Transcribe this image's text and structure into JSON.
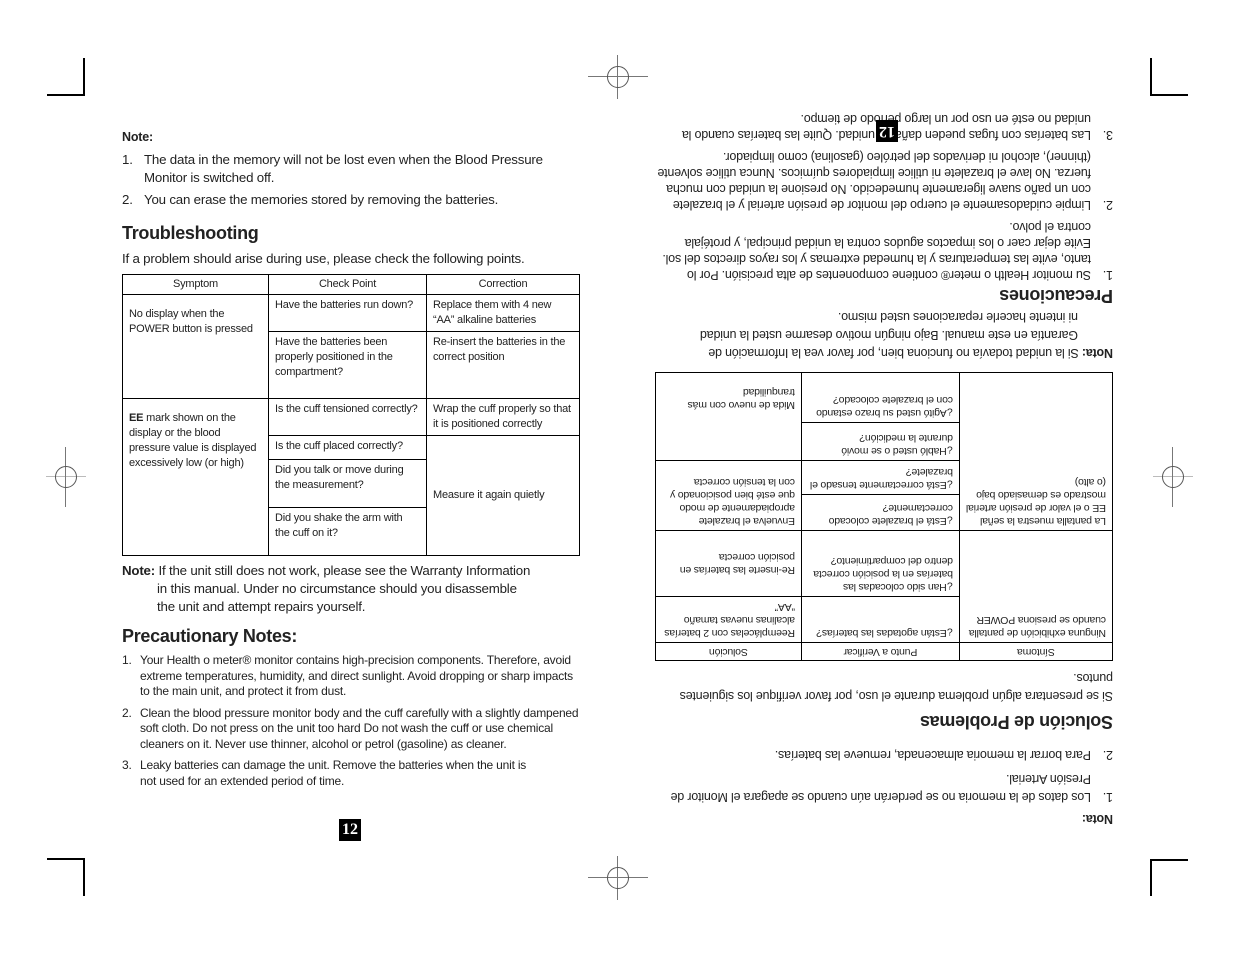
{
  "english": {
    "note_label": "Note:",
    "notes": [
      {
        "num": "1.",
        "text": "The data in the memory will not be lost even when the Blood Pressure Monitor is switched off."
      },
      {
        "num": "2.",
        "text": "You can erase the memories stored by removing the batteries."
      }
    ],
    "troubleshooting_title": "Troubleshooting",
    "troubleshooting_intro": "If a problem should arise during use, please check the following points.",
    "table": {
      "headers": [
        "Symptom",
        "Check Point",
        "Correction"
      ],
      "symptom1": "No display when the POWER button is pressed",
      "check1a": "Have the batteries run down?",
      "corr1a": "Replace them with 4 new “AA” alkaline batteries",
      "check1b": "Have the batteries been properly positioned in the compartment?",
      "corr1b": "Re-insert the batteries in the correct position",
      "symptom2_bold": "EE",
      "symptom2": " mark shown on the display or the blood pressure value is displayed excessively low (or high)",
      "check2a": "Is the cuff tensioned correctly?",
      "corr2a": "Wrap the cuff properly so that it is positioned correctly",
      "check2b": "Is the cuff placed correctly?",
      "check2c": "Did you talk or move during the measurement?",
      "check2d": "Did you shake the arm with the cuff on it?",
      "corr2bcd": "Measure it again quietly"
    },
    "warranty_label": "Note:",
    "warranty_text1": " If the unit still does not work, please see the Warranty Information",
    "warranty_text2": "in this manual. Under no circumstance should you disassemble",
    "warranty_text3": "the unit and attempt repairs yourself.",
    "precaution_title": "Precautionary Notes:",
    "precautions": [
      {
        "num": "1.",
        "text": "Your Health o meter® monitor contains high-precision components. Therefore, avoid extreme temperatures, humidity, and direct sunlight. Avoid dropping or sharp impacts to the main unit, and protect it from dust."
      },
      {
        "num": "2.",
        "text": "Clean the blood pressure monitor body and the cuff carefully with a slightly dampened soft cloth. Do not press on the unit too hard Do not wash the cuff or use chemical cleaners on it. Never use thinner, alcohol or petrol (gasoline) as cleaner."
      },
      {
        "num": "3.",
        "text": "Leaky batteries can damage the unit. Remove the batteries when the unit is not used for an extended period of time."
      }
    ],
    "page_number": "12"
  },
  "spanish": {
    "note_label": "Nota:",
    "notes": [
      {
        "num": "1.",
        "text": "Los datos de la memoria no se perderán aún cuando se apagara el Monitor de Presión Arterial."
      },
      {
        "num": "2.",
        "text": "Para borrar la memoria almacenada, remueve las baterías."
      }
    ],
    "troubleshooting_title": "Solución de Problemas",
    "troubleshooting_intro": "Si se presentara algún problema durante el uso, por favor verifique los siguientes puntos.",
    "table": {
      "headers": [
        "Síntoma",
        "Punto a Verificar",
        "Solución"
      ],
      "symptom1": "Ninguna exhibición de pantalla cuando se presiona POWER",
      "check1a": "¿Están agotadas las baterías?",
      "corr1a": "Reemplácelas con 2 baterías alcalinas nuevas tamaño “AA”",
      "check1b": "¿Han sido colocadas las baterías en la posición correcta dentro del compartimiento?",
      "corr1b": "Re-inserte las baterías en posición correcta",
      "symptom2": "La pantalla muestra la señal EE o el valor de presión arterial mostrado es demasiado bajo (o alto)",
      "check2a": "¿Está el brazalete colocado correctamente?",
      "corr2a": "Envuelva el brazalete apropiadamente de modo que esté bien posicionado y con la tensión correcta",
      "check2b": "¿Está correctamente tensado el brazalete?",
      "check2c": "¿Habló usted o se movió durante la medición?",
      "check2d": "¿Agitó usted su brazo estando con el brazalete colocado?",
      "corr2bcd": "Mida de nuevo con más tranquilidad"
    },
    "warranty_label": "Nota:",
    "warranty_text1": " Si la unidad todavía no funciona bien, por favor vea la Información de",
    "warranty_text2": "Garantía en este manual. Bajo ningún motivo desarme usted la unidad",
    "warranty_text3": "ni intente hacerle reparaciones usted mismo.",
    "precaution_title": "Precauciones",
    "precautions": [
      {
        "num": "1.",
        "text": "Su monitor Health o meter® contiene componentes de alta precisión. Por lo tanto, evite las temperaturas y la humedad extremas y los rayos directos del sol. Evite dejar caer o los impactos agudos contra la unidad principal, y protéjala contra el polvo."
      },
      {
        "num": "2.",
        "text": "Limpie cuidadosamente el cuerpo del monitor de presión arterial y el brazalete con un paño suave ligeramente humedecido. No presione la unidad con mucha fuerza. No lave el brazalete ni utilice limpiadores químicos. Nunca utilice solvente (thinner), alcohol ni derivados del petróleo (gasolina) como limpiador."
      },
      {
        "num": "3.",
        "text": "Las baterías con fugas pueden dañar la unidad. Quite las baterías cuando la unidad no esté en uso por un largo período de tiempo."
      }
    ],
    "page_number": "12"
  }
}
